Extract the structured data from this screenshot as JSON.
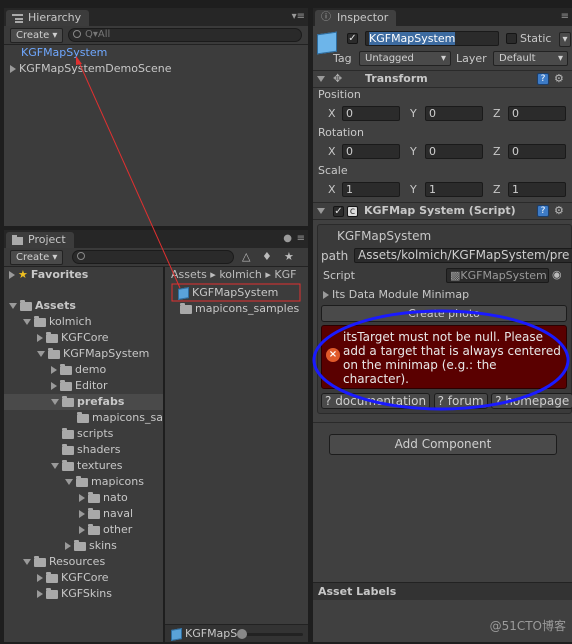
{
  "hierarchy": {
    "tab_label": "Hierarchy",
    "create_label": "Create ▾",
    "search_placeholder": "Q▾All",
    "items": [
      "KGFMapSystem",
      "KGFMapSystemDemoScene"
    ]
  },
  "project": {
    "tab_label": "Project",
    "create_label": "Create ▾",
    "favorites_label": "Favorites",
    "breadcrumb": [
      "Assets",
      "kolmich",
      "KGF"
    ],
    "tree": [
      "Assets",
      "kolmich",
      "KGFCore",
      "KGFMapSystem",
      "demo",
      "Editor",
      "prefabs",
      "mapicons_sa",
      "scripts",
      "shaders",
      "textures",
      "mapicons",
      "nato",
      "naval",
      "other",
      "skins",
      "Resources",
      "KGFCore",
      "KGFSkins"
    ],
    "files": [
      "KGFMapSystem",
      "mapicons_samples"
    ],
    "status_file": "KGFMapS"
  },
  "inspector": {
    "tab_label": "Inspector",
    "object_name": "KGFMapSystem",
    "static_label": "Static",
    "tag_label": "Tag",
    "tag_value": "Untagged",
    "layer_label": "Layer",
    "layer_value": "Default",
    "transform": {
      "title": "Transform",
      "position_label": "Position",
      "rotation_label": "Rotation",
      "scale_label": "Scale",
      "axis_x": "X",
      "axis_y": "Y",
      "axis_z": "Z",
      "position": [
        "0",
        "0",
        "0"
      ],
      "rotation": [
        "0",
        "0",
        "0"
      ],
      "scale": [
        "1",
        "1",
        "1"
      ]
    },
    "script_component": {
      "title": "KGFMap System (Script)",
      "box_title": "KGFMapSystem",
      "path_label": "path",
      "path_value": "Assets/kolmich/KGFMapSystem/pre",
      "script_label": "Script",
      "script_value": "KGFMapSystem",
      "module_label": "Its Data Module Minimap",
      "create_photo_label": "Create photo",
      "error_text": "itsTarget must not be null. Please add a target that is always centered on the minimap (e.g.: the character).",
      "links": [
        "documentation",
        "forum",
        "homepage"
      ]
    },
    "add_component_label": "Add Component",
    "asset_labels": "Asset Labels"
  },
  "watermark": "@51CTO博客",
  "colors": {
    "selection": "#3d6ba0",
    "error_bg": "#5a0000",
    "annotation_red": "#e03030",
    "annotation_blue": "#1a1aff"
  }
}
